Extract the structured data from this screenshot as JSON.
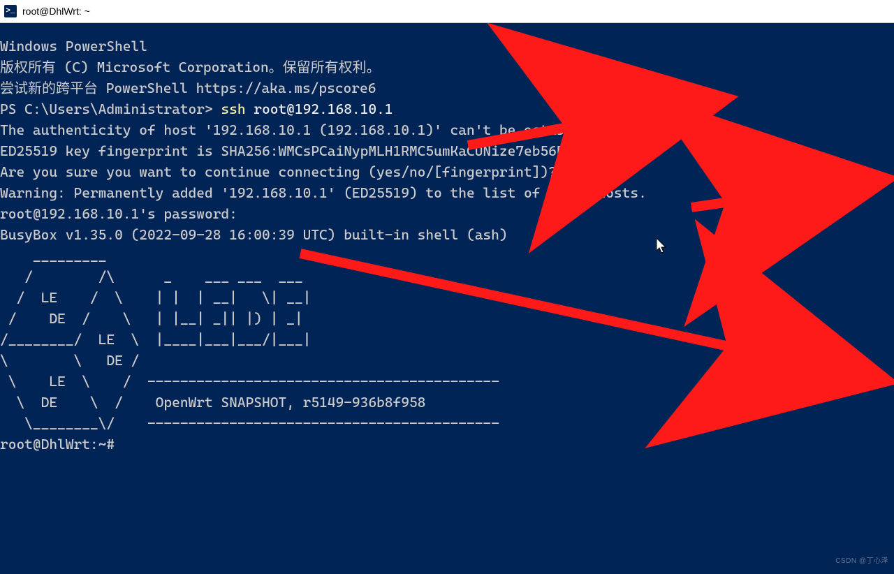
{
  "window": {
    "icon_glyph": ">_",
    "title": "root@DhlWrt: ~"
  },
  "terminal": {
    "line01": "Windows PowerShell",
    "line02": "版权所有 (C) Microsoft Corporation。保留所有权利。",
    "line03": "",
    "line04": "尝试新的跨平台 PowerShell https://aka.ms/pscore6",
    "line05": "",
    "prompt1_prefix": "PS C:\\Users\\Administrator> ",
    "prompt1_cmd": "ssh ",
    "prompt1_arg": "root@192.168.10.1",
    "line07": "The authenticity of host '192.168.10.1 (192.168.10.1)' can't be established.",
    "line08": "ED25519 key fingerprint is SHA256:WMCsPCaiNypMLH1RMC5umKaCUNize7eb56B6UgTESec.",
    "line09": "Are you sure you want to continue connecting (yes/no/[fingerprint])? yes",
    "line10": "Warning: Permanently added '192.168.10.1' (ED25519) to the list of known hosts.",
    "line11": "root@192.168.10.1's password:",
    "line12": "",
    "line13": "",
    "line14": "BusyBox v1.35.0 (2022-09-28 16:00:39 UTC) built-in shell (ash)",
    "line15": "",
    "ascii01": "    _________",
    "ascii02": "   /        /\\      _    ___ ___  ___",
    "ascii03": "  /  LE    /  \\    | |  | __|   \\| __|",
    "ascii04": " /    DE  /    \\   | |__| _|| |) | _|",
    "ascii05": "/________/  LE  \\  |____|___|___/|___|",
    "ascii06": "\\        \\   DE /",
    "ascii07": " \\    LE  \\    /  -------------------------------------------",
    "ascii08": "  \\  DE    \\  /    OpenWrt SNAPSHOT, r5149-936b8f958",
    "ascii09": "   \\________\\/    -------------------------------------------",
    "line25": "",
    "line26": "root@DhlWrt:~#"
  },
  "watermark": "CSDN @丁心泽"
}
